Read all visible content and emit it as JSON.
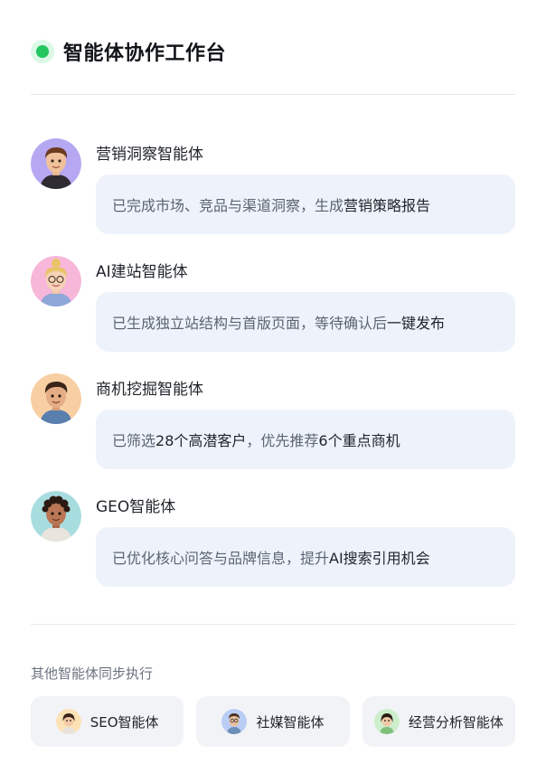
{
  "header": {
    "title": "智能体协作工作台",
    "status_color": "#22c55e"
  },
  "agents": [
    {
      "name": "营销洞察智能体",
      "status_prefix": "已完成市场、竞品与渠道洞察，生成",
      "status_highlight": "营销策略报告",
      "avatar_bg": "#b6a7f2",
      "avatar_icon": "avatar-man-brown-hair-icon"
    },
    {
      "name": "AI建站智能体",
      "status_prefix": "已生成独立站结构与首版页面，等待确认后",
      "status_highlight": "一键发布",
      "avatar_bg": "#f7b7d9",
      "avatar_icon": "avatar-woman-blonde-glasses-icon"
    },
    {
      "name": "商机挖掘智能体",
      "status_prefix": "已筛选",
      "status_highlight": "28个高潜客户",
      "status_middle": "，优先推荐",
      "status_highlight2": "6个重点商机",
      "avatar_bg": "#f8cfa3",
      "avatar_icon": "avatar-man-dark-hair-icon"
    },
    {
      "name": "GEO智能体",
      "status_prefix": "已优化核心问答与品牌信息，提升",
      "status_highlight": "AI搜索引用机会",
      "avatar_bg": "#a8dde0",
      "avatar_icon": "avatar-man-curly-hair-icon"
    }
  ],
  "others": {
    "title": "其他智能体同步执行",
    "items": [
      {
        "label": "SEO智能体",
        "avatar_bg": "#fde2b5",
        "avatar_icon": "avatar-woman-icon"
      },
      {
        "label": "社媒智能体",
        "avatar_bg": "#b9cdf5",
        "avatar_icon": "avatar-man-glasses-icon"
      },
      {
        "label": "经营分析智能体",
        "avatar_bg": "#cdeecb",
        "avatar_icon": "avatar-woman-green-icon"
      }
    ]
  }
}
